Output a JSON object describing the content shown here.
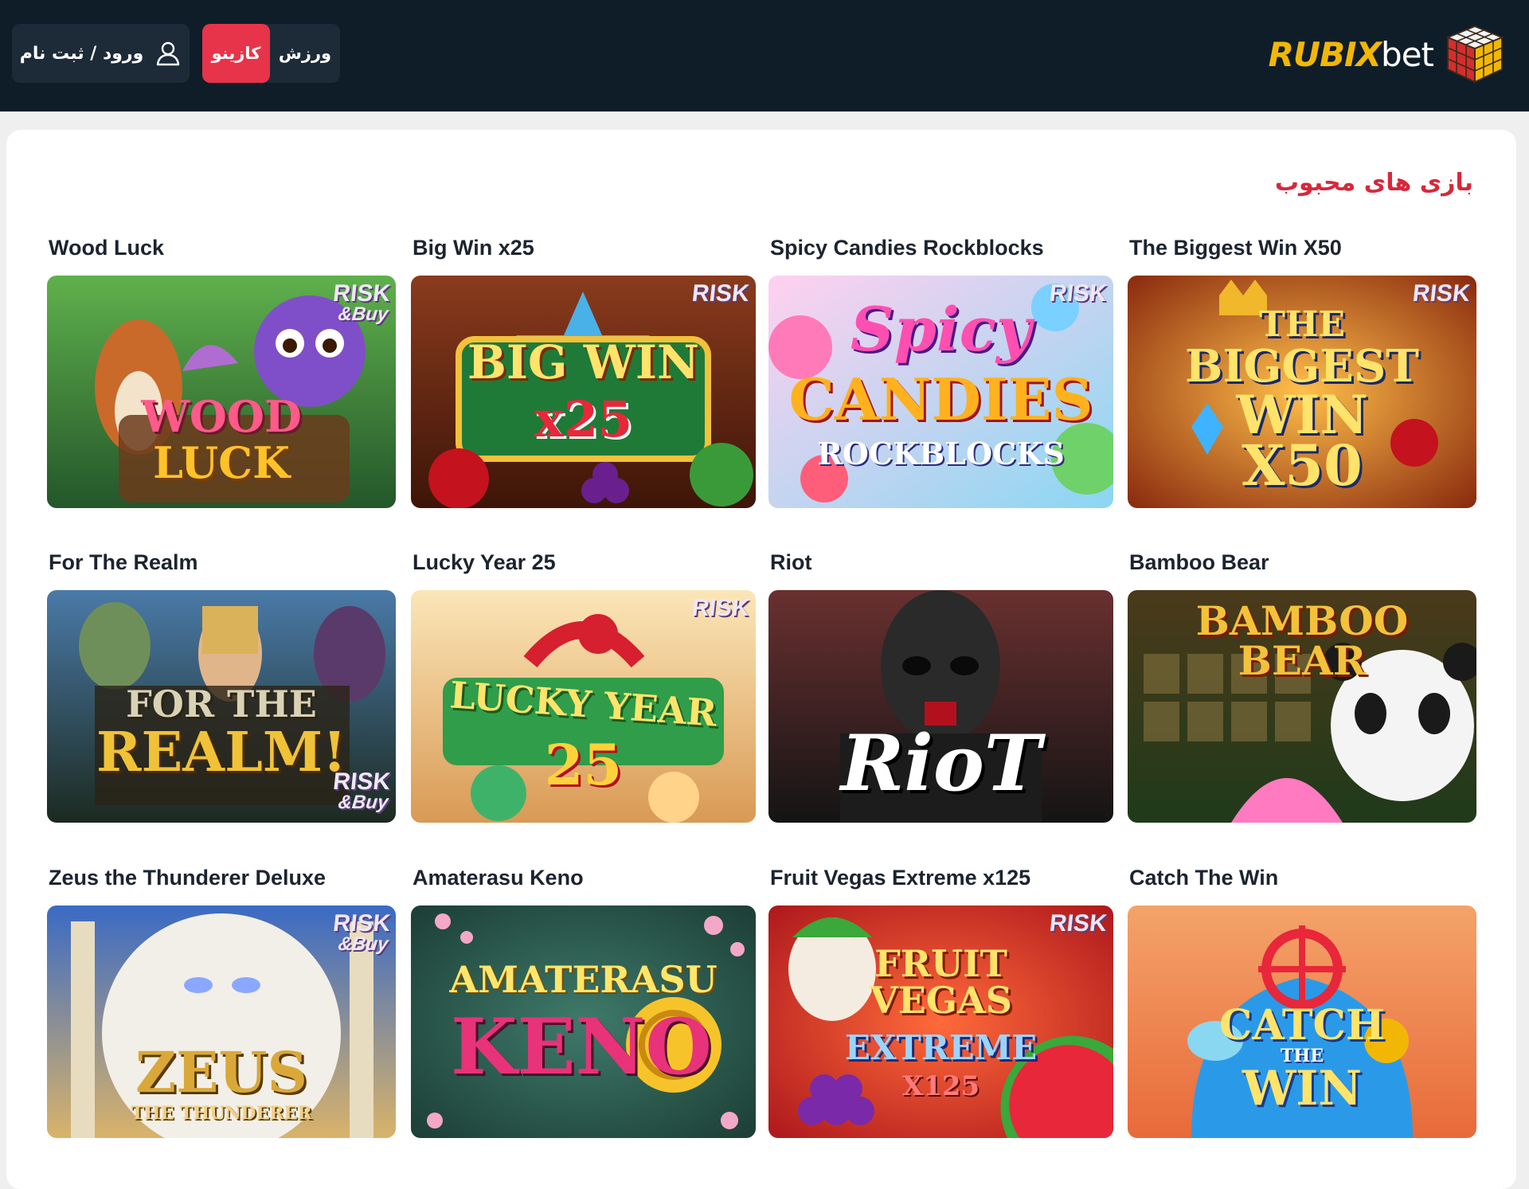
{
  "header": {
    "logo_text_main": "RUBIX",
    "logo_text_suffix": "bet",
    "logo_icon": "cube-icon",
    "nav": [
      {
        "label": "ورزش",
        "active": false
      },
      {
        "label": "کازینو",
        "active": true
      }
    ],
    "login_label": "ورود / ثبت نام",
    "login_icon": "user-icon"
  },
  "colors": {
    "header_bg": "#0f1d29",
    "accent_red": "#e8344b",
    "logo_yellow": "#f2b705",
    "section_title_red": "#d7283a"
  },
  "section": {
    "title": "بازی های محبوب"
  },
  "games": [
    {
      "title": "Wood Luck",
      "art_text": [
        "WOOD",
        "LUCK"
      ],
      "badge": "RISK",
      "badge_sub": "&Buy"
    },
    {
      "title": "Big Win x25",
      "art_text": [
        "BIG WIN",
        "x25"
      ],
      "badge": "RISK",
      "badge_sub": ""
    },
    {
      "title": "Spicy Candies Rockblocks",
      "art_text": [
        "Spicy",
        "CANDIES",
        "ROCKBLOCKS"
      ],
      "badge": "RISK",
      "badge_sub": ""
    },
    {
      "title": "The Biggest Win X50",
      "art_text": [
        "THE",
        "BIGGEST",
        "WIN",
        "X50"
      ],
      "badge": "RISK",
      "badge_sub": ""
    },
    {
      "title": "For The Realm",
      "art_text": [
        "FOR THE",
        "REALM!"
      ],
      "badge": "RISK",
      "badge_sub": "&Buy"
    },
    {
      "title": "Lucky Year 25",
      "art_text": [
        "LUCKY YEAR",
        "25"
      ],
      "badge": "RISK",
      "badge_sub": ""
    },
    {
      "title": "Riot",
      "art_text": [
        "RioT"
      ],
      "badge": "",
      "badge_sub": ""
    },
    {
      "title": "Bamboo Bear",
      "art_text": [
        "BAMBOO BEAR"
      ],
      "badge": "",
      "badge_sub": ""
    },
    {
      "title": "Zeus the Thunderer Deluxe",
      "art_text": [
        "ZEUS",
        "THE THUNDERER"
      ],
      "badge": "RISK",
      "badge_sub": "&Buy"
    },
    {
      "title": "Amaterasu Keno",
      "art_text": [
        "AMATERASU",
        "KENO"
      ],
      "badge": "",
      "badge_sub": ""
    },
    {
      "title": "Fruit Vegas Extreme x125",
      "art_text": [
        "FRUIT",
        "VEGAS",
        "EXTREME",
        "X125"
      ],
      "badge": "RISK",
      "badge_sub": ""
    },
    {
      "title": "Catch The Win",
      "art_text": [
        "CATCH",
        "THE",
        "WIN"
      ],
      "badge": "",
      "badge_sub": ""
    }
  ]
}
